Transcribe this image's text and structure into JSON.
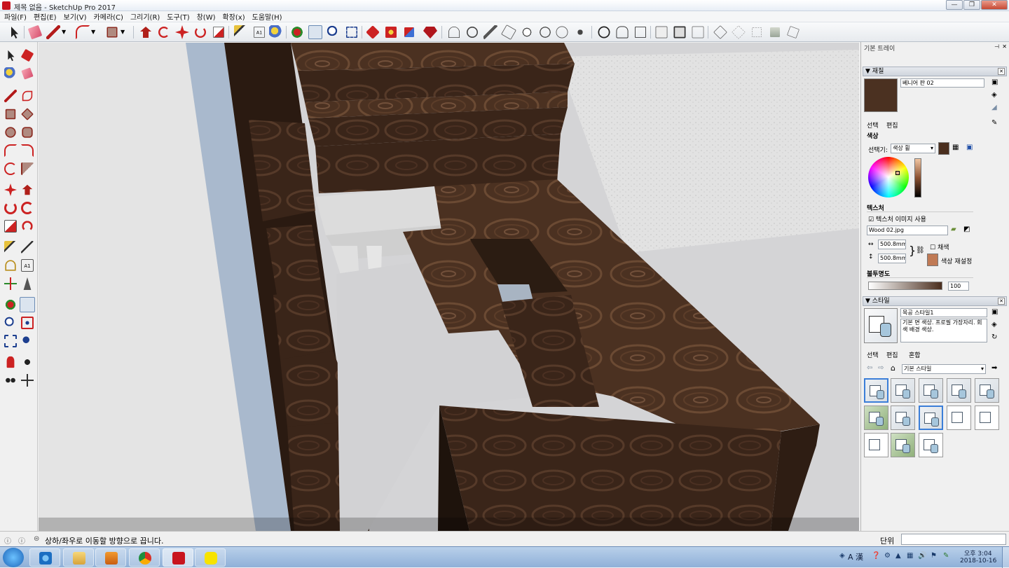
{
  "window": {
    "title": "제목 없음 - SketchUp Pro 2017",
    "controls": [
      "—",
      "❐",
      "✕"
    ]
  },
  "menu": [
    "파일(F)",
    "편집(E)",
    "보기(V)",
    "카메라(C)",
    "그리기(R)",
    "도구(T)",
    "창(W)",
    "확장(x)",
    "도움말(H)"
  ],
  "tray": {
    "title": "기본 트레이",
    "materials": {
      "header": "재질",
      "name": "베니어 판 02",
      "tabs": [
        "선택",
        "편집"
      ],
      "color_section": "색상",
      "picker_label": "선택기:",
      "picker_value": "색상 휠",
      "swatch_color": "#4a2e1e",
      "texture_section": "텍스처",
      "use_texture_label": "텍스처 이미지 사용",
      "texture_file": "Wood 02.jpg",
      "width": "500.8mm",
      "height": "500.8mm",
      "colorize_label": "채색",
      "reset_label": "색상 재설정",
      "opacity_section": "불투명도",
      "opacity": "100"
    },
    "styles": {
      "header": "스타일",
      "name": "목공 스타일1",
      "description": "기본 면 색상. 프로필 가장자리. 회색 배경 색상.",
      "tabs": [
        "선택",
        "편집",
        "혼합"
      ],
      "collection": "기본 스타일"
    }
  },
  "status": {
    "hint": "상하/좌우로 이동할 방향으로 끕니다.",
    "measure_label": "단위",
    "measure_value": ""
  },
  "taskbar": {
    "time": "오후 3:04",
    "date": "2018-10-16",
    "ime": "A 漢"
  }
}
